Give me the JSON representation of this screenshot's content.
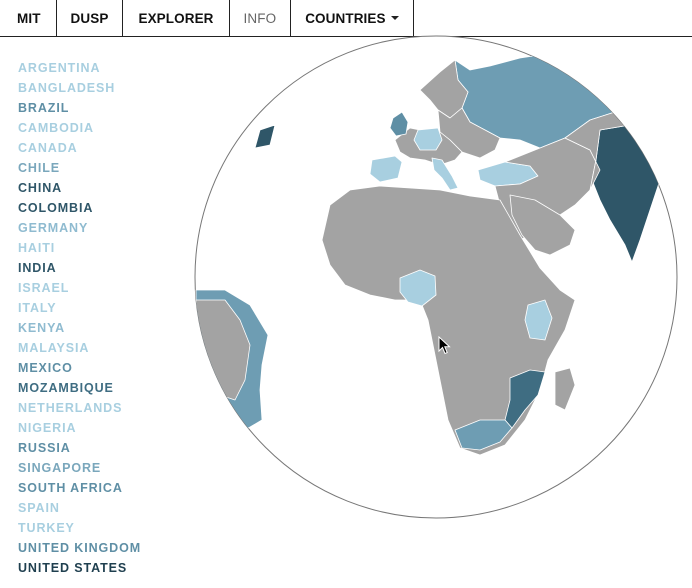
{
  "nav": {
    "mit": "MIT",
    "dusp": "DUSP",
    "explorer": "EXPLORER",
    "info": "INFO",
    "countries": "COUNTRIES"
  },
  "countries": [
    {
      "name": "ARGENTINA",
      "color": "#a8cfe0"
    },
    {
      "name": "BANGLADESH",
      "color": "#a8cfe0"
    },
    {
      "name": "BRAZIL",
      "color": "#5f8fa5"
    },
    {
      "name": "CAMBODIA",
      "color": "#a8cfe0"
    },
    {
      "name": "CANADA",
      "color": "#a8cfe0"
    },
    {
      "name": "CHILE",
      "color": "#7aa7bc"
    },
    {
      "name": "CHINA",
      "color": "#2f5668"
    },
    {
      "name": "COLOMBIA",
      "color": "#2f5668"
    },
    {
      "name": "GERMANY",
      "color": "#8fbbd0"
    },
    {
      "name": "HAITI",
      "color": "#a8cfe0"
    },
    {
      "name": "INDIA",
      "color": "#2f5668"
    },
    {
      "name": "ISRAEL",
      "color": "#a8cfe0"
    },
    {
      "name": "ITALY",
      "color": "#a8cfe0"
    },
    {
      "name": "KENYA",
      "color": "#8fbbd0"
    },
    {
      "name": "MALAYSIA",
      "color": "#a8cfe0"
    },
    {
      "name": "MEXICO",
      "color": "#5f8fa5"
    },
    {
      "name": "MOZAMBIQUE",
      "color": "#3f6d82"
    },
    {
      "name": "NETHERLANDS",
      "color": "#a8cfe0"
    },
    {
      "name": "NIGERIA",
      "color": "#a8cfe0"
    },
    {
      "name": "RUSSIA",
      "color": "#5f8fa5"
    },
    {
      "name": "SINGAPORE",
      "color": "#7aa7bc"
    },
    {
      "name": "SOUTH AFRICA",
      "color": "#5f8fa5"
    },
    {
      "name": "SPAIN",
      "color": "#a8cfe0"
    },
    {
      "name": "TURKEY",
      "color": "#a8cfe0"
    },
    {
      "name": "UNITED KINGDOM",
      "color": "#5f8fa5"
    },
    {
      "name": "UNITED STATES",
      "color": "#1f3f4f"
    }
  ],
  "globe": {
    "ocean": "#ffffff",
    "land": "#a3a3a3",
    "border": "#ffffff",
    "outline": "#777777"
  },
  "icons": {
    "caret": "caret-down-icon",
    "cursor": "mouse-pointer-icon"
  }
}
